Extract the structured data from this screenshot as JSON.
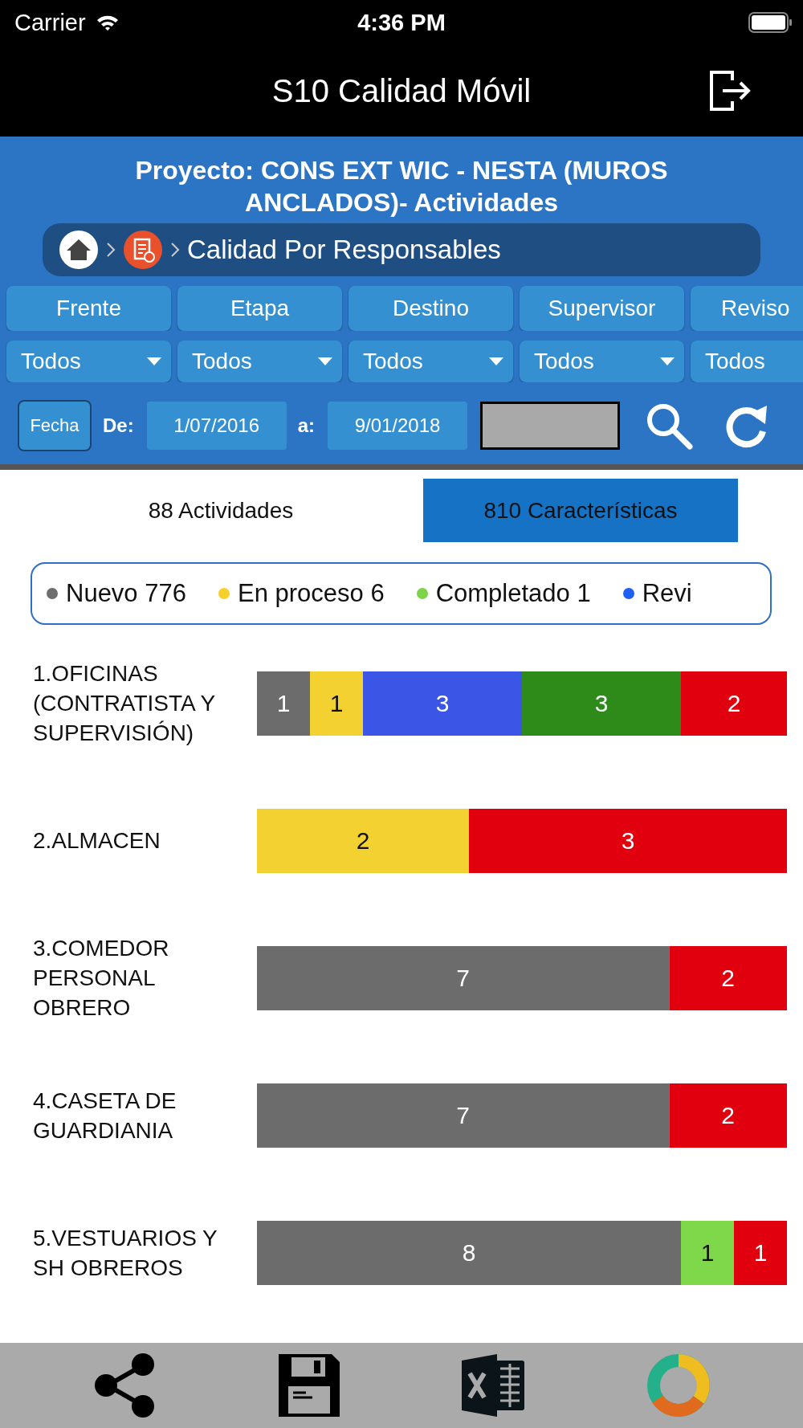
{
  "status_bar": {
    "carrier": "Carrier",
    "time": "4:36 PM"
  },
  "nav_bar": {
    "title": "S10 Calidad Móvil"
  },
  "header": {
    "title": "Proyecto: CONS EXT WIC - NESTA (MUROS ANCLADOS)- Actividades",
    "breadcrumb": "Calidad Por Responsables"
  },
  "filters": [
    {
      "label": "Frente",
      "value": "Todos"
    },
    {
      "label": "Etapa",
      "value": "Todos"
    },
    {
      "label": "Destino",
      "value": "Todos"
    },
    {
      "label": "Supervisor",
      "value": "Todos"
    },
    {
      "label": "Reviso",
      "value": "Todos"
    }
  ],
  "date_filter": {
    "button": "Fecha",
    "from_label": "De:",
    "from": "1/07/2016",
    "to_label": "a:",
    "to": "9/01/2018"
  },
  "tabs": [
    {
      "label": "88 Actividades",
      "selected": false
    },
    {
      "label": "810 Características",
      "selected": true
    }
  ],
  "legend": [
    {
      "label": "Nuevo 776",
      "color": "#6e6e6e"
    },
    {
      "label": "En proceso 6",
      "color": "#f6d12c"
    },
    {
      "label": "Completado 1",
      "color": "#7ed348"
    },
    {
      "label": "Revi",
      "color": "#1f5ff5"
    }
  ],
  "rows": [
    {
      "label": "1.OFICINAS (CONTRATISTA Y SUPERVISIÓN)",
      "segments": [
        {
          "value": "1",
          "color": "#6c6c6c"
        },
        {
          "value": "1",
          "color": "#f2d130"
        },
        {
          "value": "3",
          "color": "#3b55e6"
        },
        {
          "value": "3",
          "color": "#2e8b1a"
        },
        {
          "value": "2",
          "color": "#e0000e"
        }
      ]
    },
    {
      "label": "2.ALMACEN",
      "segments": [
        {
          "value": "2",
          "color": "#f2d130"
        },
        {
          "value": "3",
          "color": "#e0000e"
        }
      ]
    },
    {
      "label": "3.COMEDOR PERSONAL OBRERO",
      "segments": [
        {
          "value": "7",
          "color": "#6c6c6c"
        },
        {
          "value": "2",
          "color": "#e0000e"
        }
      ]
    },
    {
      "label": "4.CASETA DE GUARDIANIA",
      "segments": [
        {
          "value": "7",
          "color": "#6c6c6c"
        },
        {
          "value": "2",
          "color": "#e0000e"
        }
      ]
    },
    {
      "label": "5.VESTUARIOS Y SH OBREROS",
      "segments": [
        {
          "value": "8",
          "color": "#6c6c6c"
        },
        {
          "value": "1",
          "color": "#7ed84a"
        },
        {
          "value": "1",
          "color": "#e0000e"
        }
      ]
    }
  ]
}
